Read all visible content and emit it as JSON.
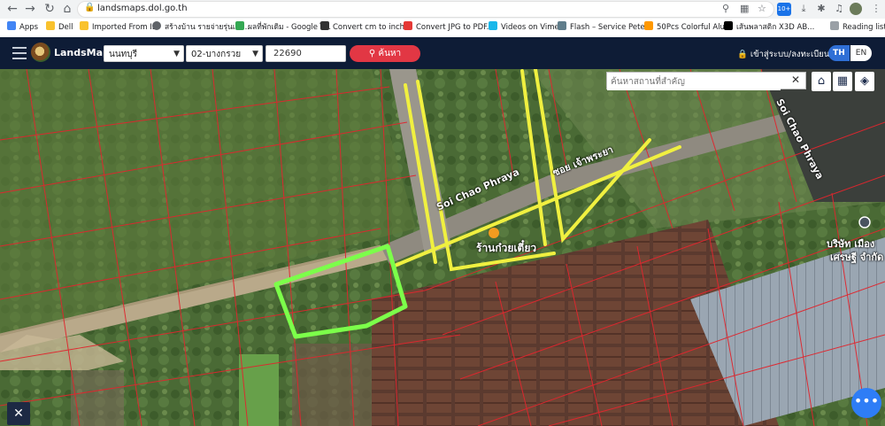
{
  "browser": {
    "url": "landsmaps.dol.go.th",
    "extension_badge": "10+",
    "bookmarks": [
      {
        "label": "Apps",
        "color": "#4285f4"
      },
      {
        "label": "Dell",
        "color": "#f9c22e"
      },
      {
        "label": "Imported From IE",
        "color": "#f9c22e"
      },
      {
        "label": "สร้างบ้าน รายจ่ายรุ่นแพ...",
        "color": "#5f6368"
      },
      {
        "label": "ผลที่พักเดิม - Google ไ...",
        "color": "#34a853"
      },
      {
        "label": "Convert cm to inch...",
        "color": "#333333"
      },
      {
        "label": "Convert JPG to PDF...",
        "color": "#e53935"
      },
      {
        "label": "Videos on Vimeo",
        "color": "#1ab7ea"
      },
      {
        "label": "Flash – Service Pete...",
        "color": "#607d8b"
      },
      {
        "label": "50Pcs Colorful Alu...",
        "color": "#ff9800"
      },
      {
        "label": "เส้นพลาสติก X3D AB...",
        "color": "#000000"
      }
    ],
    "reading_list": "Reading list"
  },
  "header": {
    "brand": "LandsMaps",
    "province": "นนทบุรี",
    "district": "02-บางกรวย",
    "parcel_number": "22690",
    "search_label": "ค้นหา",
    "login_label": "เข้าสู่ระบบ/ลงทะเบียน",
    "lang_th": "TH",
    "lang_en": "EN"
  },
  "map": {
    "place_search_placeholder": "ค้นหาสถานที่สำคัญ",
    "road_label_th": "ซอย เจ้าพระยา",
    "road_label_en": "Soi Chao Phraya",
    "road_label_en_2": "Soi Chao Phraya",
    "poi_label": "ร้านก๋วยเตี๋ยว",
    "company_label_1": "บริษัท เมือง",
    "company_label_2": "เศรษฐี จำกัด",
    "colors": {
      "parcel_line": "#e0262e",
      "highlight": "#7cff4a",
      "marker": "#f0f040"
    }
  }
}
